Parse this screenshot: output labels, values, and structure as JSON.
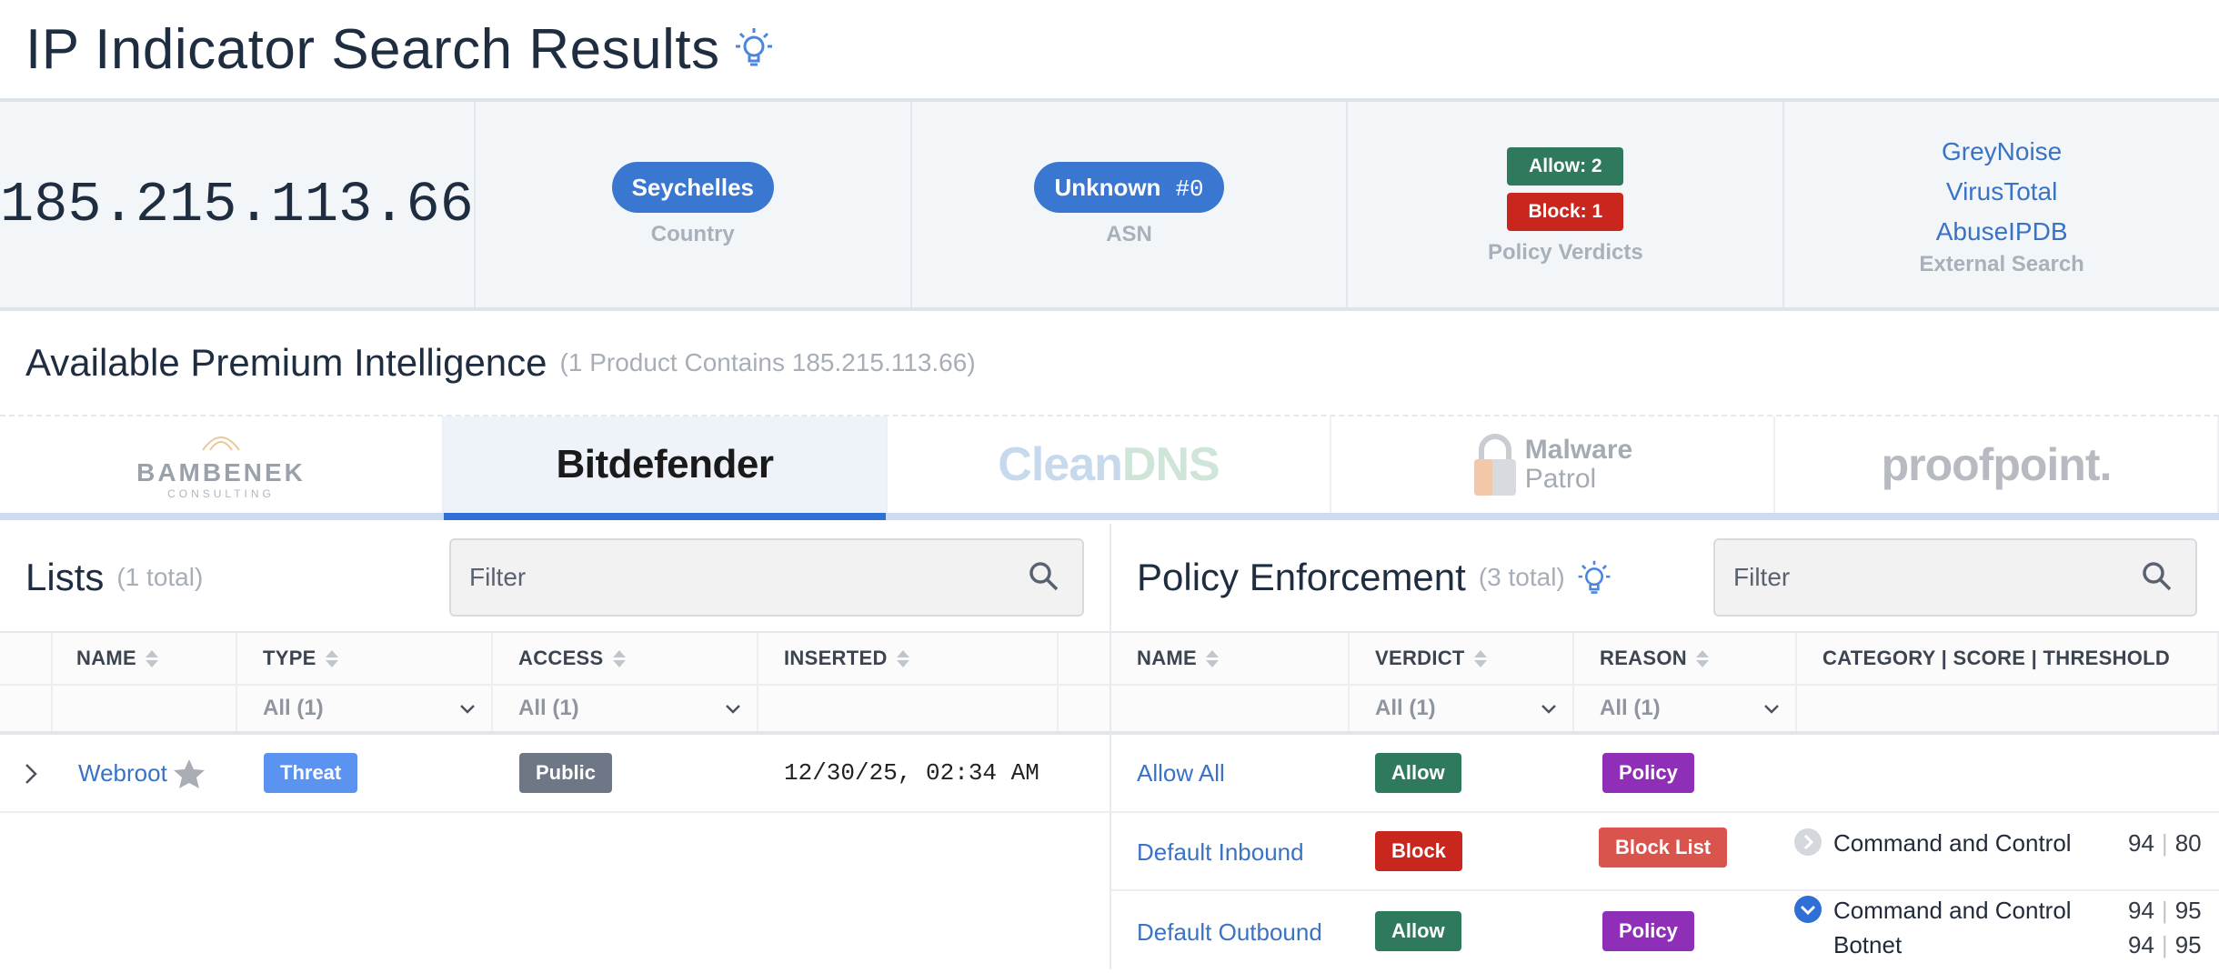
{
  "header": {
    "title": "IP Indicator Search Results"
  },
  "summary": {
    "ip": "185.215.113.66",
    "country": {
      "value": "Seychelles",
      "label": "Country"
    },
    "asn": {
      "value": "Unknown",
      "number": "#0",
      "label": "ASN"
    },
    "verdicts": {
      "allow": "Allow: 2",
      "block": "Block: 1",
      "label": "Policy Verdicts"
    },
    "external": {
      "links": [
        "GreyNoise",
        "VirusTotal",
        "AbuseIPDB"
      ],
      "label": "External Search"
    }
  },
  "premium": {
    "title": "Available Premium Intelligence",
    "meta": "(1 Product Contains 185.215.113.66)"
  },
  "vendors": [
    {
      "name": "BAMBENEK",
      "sub": "CONSULTING"
    },
    {
      "name": "Bitdefender"
    },
    {
      "name": "CleanDNS",
      "part1": "Clean",
      "part2": "DNS"
    },
    {
      "name": "Malware Patrol",
      "part1": "Malware",
      "part2": "Patrol"
    },
    {
      "name": "proofpoint."
    }
  ],
  "lists": {
    "title": "Lists",
    "meta": "(1 total)",
    "filter_placeholder": "Filter",
    "columns": [
      "NAME",
      "TYPE",
      "ACCESS",
      "INSERTED"
    ],
    "filters": {
      "type": "All (1)",
      "access": "All (1)"
    },
    "rows": [
      {
        "name": "Webroot",
        "type": "Threat",
        "access": "Public",
        "inserted": "12/30/25, 02:34 AM"
      }
    ]
  },
  "policy": {
    "title": "Policy Enforcement",
    "meta": "(3 total)",
    "filter_placeholder": "Filter",
    "columns": [
      "NAME",
      "VERDICT",
      "REASON",
      "CATEGORY | SCORE | THRESHOLD"
    ],
    "filters": {
      "verdict": "All (1)",
      "reason": "All (1)"
    },
    "rows": [
      {
        "name": "Allow All",
        "verdict": "Allow",
        "reason": "Policy"
      },
      {
        "name": "Default Inbound",
        "verdict": "Block",
        "reason": "Block List",
        "categories": [
          {
            "name": "Command and Control",
            "score": "94",
            "threshold": "80"
          }
        ]
      },
      {
        "name": "Default Outbound",
        "verdict": "Allow",
        "reason": "Policy",
        "categories": [
          {
            "name": "Command and Control",
            "score": "94",
            "threshold": "95"
          },
          {
            "name": "Botnet",
            "score": "94",
            "threshold": "95"
          }
        ]
      }
    ]
  },
  "colors": {
    "accent": "#3a77d0",
    "allow": "#2f7a5d",
    "block": "#c9261e",
    "policy": "#8f2fb8",
    "threat": "#5b93f0"
  }
}
